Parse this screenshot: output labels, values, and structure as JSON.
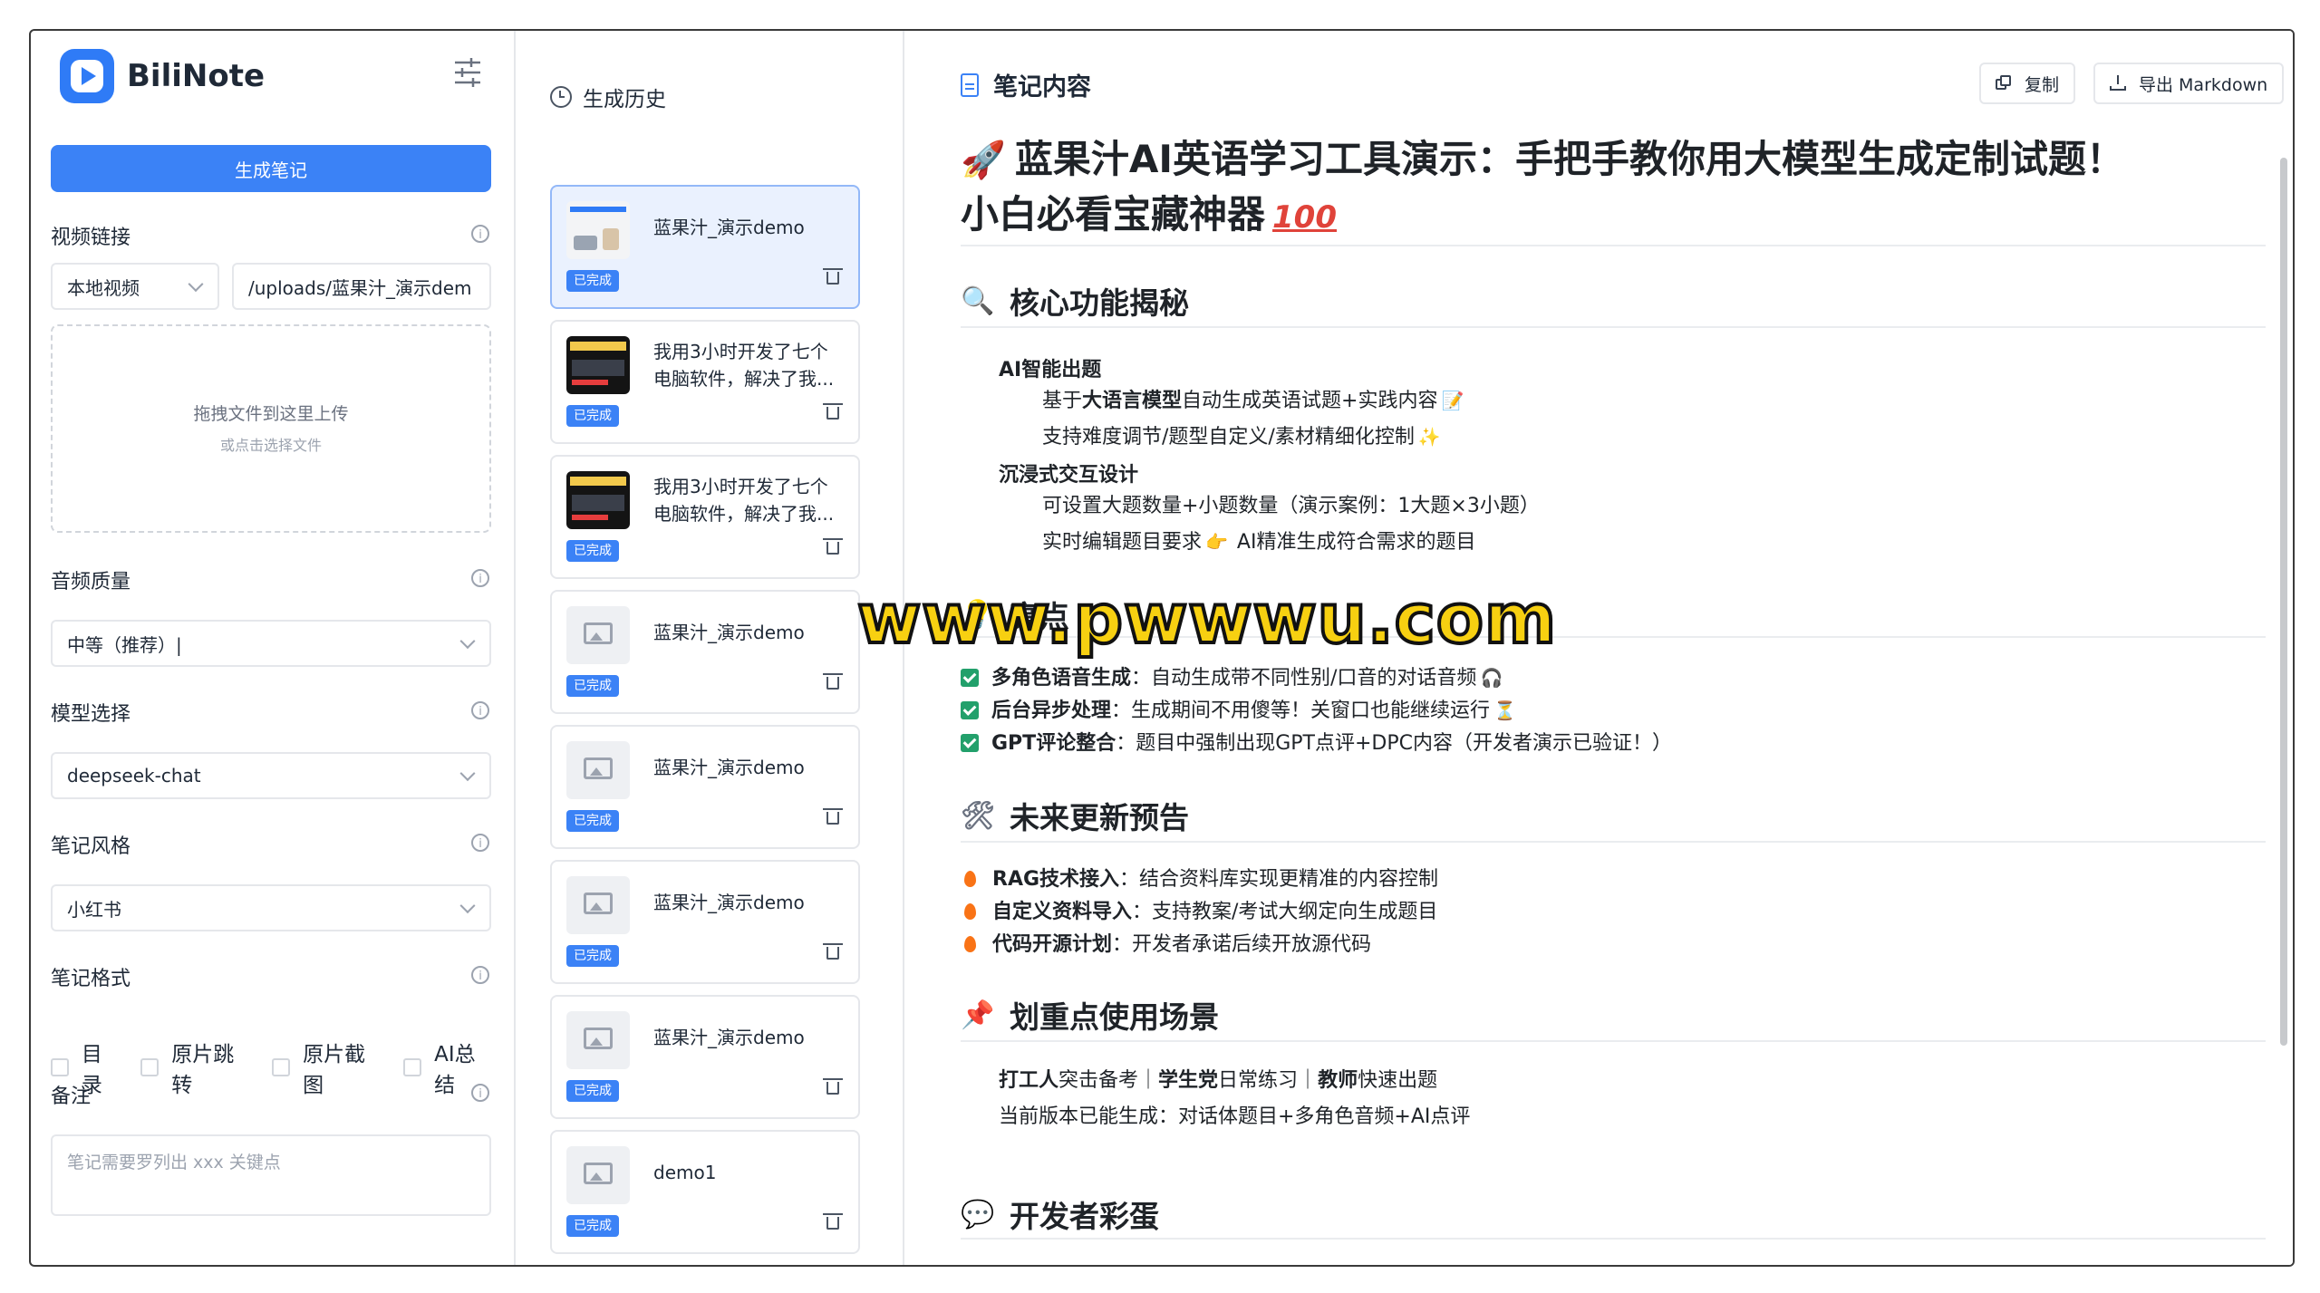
{
  "app": {
    "name": "BiliNote"
  },
  "left": {
    "generate_button": "生成笔记",
    "video_link_label": "视频链接",
    "source_select": "本地视频",
    "path_value": "/uploads/蓝果汁_演示dem",
    "dropzone_main": "拖拽文件到这里上传",
    "dropzone_sub": "或点击选择文件",
    "audio_quality_label": "音频质量",
    "audio_quality_value": "中等（推荐）|",
    "model_label": "模型选择",
    "model_value": "deepseek-chat",
    "style_label": "笔记风格",
    "style_value": "小红书",
    "format_label": "笔记格式",
    "format_options": [
      "目录",
      "原片跳转",
      "原片截图",
      "AI总结"
    ],
    "notes_label": "备注",
    "notes_placeholder": "笔记需要罗列出 xxx 关键点"
  },
  "history": {
    "title": "生成历史",
    "status_badge": "已完成",
    "items": [
      {
        "title": "蓝果汁_演示demo",
        "thumb": "light"
      },
      {
        "title": "我用3小时开发了七个电脑软件，解决了我...",
        "thumb": "dark"
      },
      {
        "title": "我用3小时开发了七个电脑软件，解决了我...",
        "thumb": "dark"
      },
      {
        "title": "蓝果汁_演示demo",
        "thumb": "placeholder"
      },
      {
        "title": "蓝果汁_演示demo",
        "thumb": "placeholder"
      },
      {
        "title": "蓝果汁_演示demo",
        "thumb": "placeholder"
      },
      {
        "title": "蓝果汁_演示demo",
        "thumb": "placeholder"
      },
      {
        "title": "demo1",
        "thumb": "placeholder"
      }
    ]
  },
  "note": {
    "header": "笔记内容",
    "copy_button": "复制",
    "export_button": "导出 Markdown",
    "title_line1": "蓝果汁AI英语学习工具演示：手把手教你用大模型生成定制试题！",
    "title_line2": "小白必看宝藏神器",
    "sections": {
      "core": "核心功能揭秘",
      "core_sub1": "AI智能出题",
      "core_l1a_pre": "基于",
      "core_l1a_bold": "大语言模型",
      "core_l1a_post": "自动生成英语试题+实践内容",
      "core_l1b": "支持难度调节/题型自定义/素材精细化控制",
      "core_sub2": "沉浸式交互设计",
      "core_l2a": "可设置大题数量+小题数量（演示案例：1大题×3小题）",
      "core_l2b_pre": "实时编辑题目要求",
      "core_l2b_post": "AI精准生成符合需求的题目",
      "highlight": "亮点",
      "hl1_bold": "多角色语音生成",
      "hl1_text": "：自动生成带不同性别/口音的对话音频",
      "hl2_bold": "后台异步处理",
      "hl2_text": "：生成期间不用傻等！关窗口也能继续运行",
      "hl3_bold": "GPT评论整合",
      "hl3_text": "：题目中强制出现GPT点评+DPC内容（开发者演示已验证！）",
      "future": "未来更新预告",
      "f1_bold": "RAG技术接入",
      "f1_text": "：结合资料库实现更精准的内容控制",
      "f2_bold": "自定义资料导入",
      "f2_text": "：支持教案/考试大纲定向生成题目",
      "f3_bold": "代码开源计划",
      "f3_text": "：开发者承诺后续开放源代码",
      "scenes": "划重点使用场景",
      "s1_b1": "打工人",
      "s1_t1": "突击备考｜",
      "s1_b2": "学生党",
      "s1_t2": "日常练习｜",
      "s1_b3": "教师",
      "s1_t3": "快速出题",
      "s2": "当前版本已能生成：对话体题目+多角色音频+AI点评",
      "easter": "开发者彩蛋"
    }
  },
  "watermark": "www.pwwwu.com",
  "colors": {
    "accent": "#3b82f6",
    "check": "#22a06b",
    "flame": "#f97316",
    "watermark": "#f7d011"
  }
}
